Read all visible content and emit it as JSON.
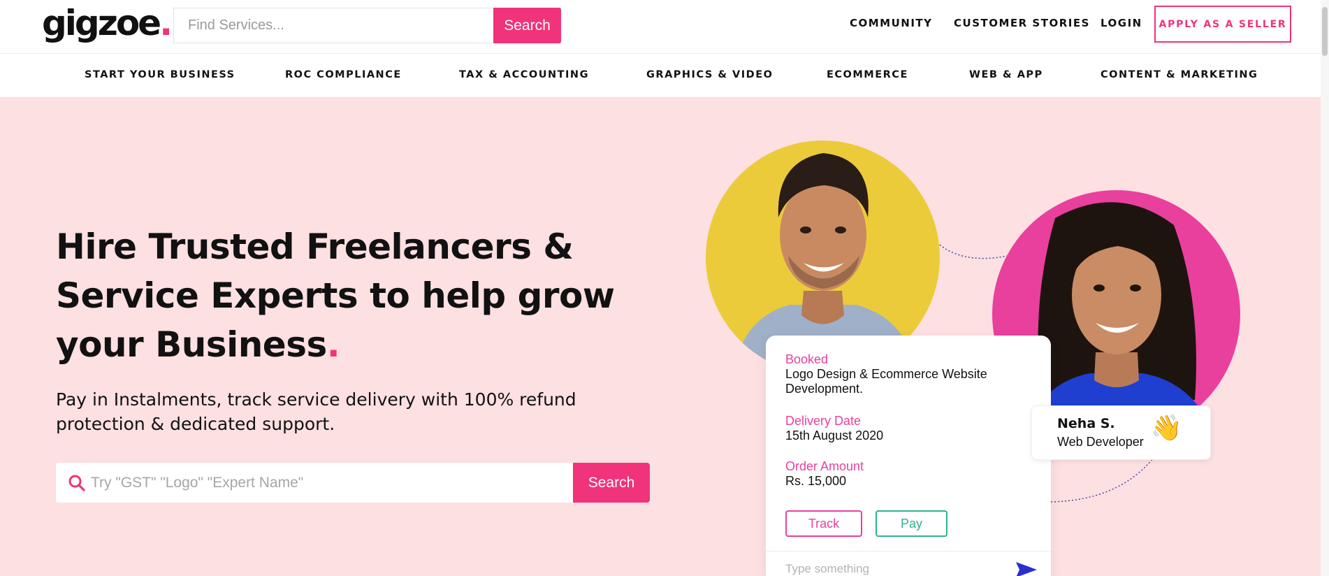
{
  "header": {
    "logo_text": "gigzoe",
    "logo_dot": ".",
    "search_placeholder": "Find Services...",
    "search_button": "Search",
    "links": [
      "COMMUNITY",
      "CUSTOMER STORIES",
      "LOGIN"
    ],
    "apply_button": "APPLY AS A SELLER"
  },
  "categories": [
    "START YOUR BUSINESS",
    "ROC COMPLIANCE",
    "TAX & ACCOUNTING",
    "GRAPHICS & VIDEO",
    "ECOMMERCE",
    "WEB & APP",
    "CONTENT & MARKETING"
  ],
  "hero": {
    "title": "Hire Trusted Freelancers & Service Experts to help grow your Business",
    "title_dot": ".",
    "subtitle": "Pay in Instalments, track service delivery with 100% refund protection & dedicated support.",
    "search_placeholder": "Try \"GST\" \"Logo\" \"Expert Name\"",
    "search_button": "Search"
  },
  "order_card": {
    "booked_label": "Booked",
    "booked_value": "Logo Design & Ecommerce Website Development.",
    "delivery_label": "Delivery Date",
    "delivery_value": "15th August 2020",
    "amount_label": "Order Amount",
    "amount_value": "Rs. 15,000",
    "track_button": "Track",
    "pay_button": "Pay",
    "message_placeholder": "Type something"
  },
  "profile_card": {
    "name": "Neha S.",
    "role": "Web Developer",
    "emoji": "👋"
  },
  "colors": {
    "brand_pink": "#f0337a",
    "hero_bg": "#fde0e2",
    "yellow_circle": "#eccb3a",
    "pink_circle": "#e9409e",
    "pay_green": "#2bb38f"
  }
}
